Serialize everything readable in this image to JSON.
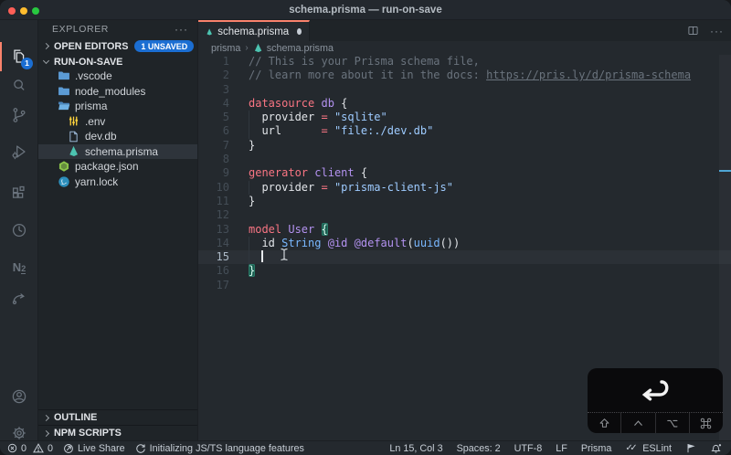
{
  "window": {
    "title": "schema.prisma — run-on-save"
  },
  "activity_bar": {
    "explorer_badge": "1",
    "n2_main": "N",
    "n2_sub": "2"
  },
  "sidebar": {
    "title": "EXPLORER",
    "open_editors_label": "OPEN EDITORS",
    "unsaved_badge": "1 UNSAVED",
    "root_label": "RUN-ON-SAVE",
    "files": [
      {
        "name": ".vscode",
        "icon": "folder",
        "indent": 0
      },
      {
        "name": "node_modules",
        "icon": "folder",
        "indent": 0
      },
      {
        "name": "prisma",
        "icon": "folder-open",
        "indent": 0
      },
      {
        "name": ".env",
        "icon": "env",
        "indent": 1
      },
      {
        "name": "dev.db",
        "icon": "file",
        "indent": 1
      },
      {
        "name": "schema.prisma",
        "icon": "prisma",
        "indent": 1,
        "selected": true
      },
      {
        "name": "package.json",
        "icon": "npm",
        "indent": 0
      },
      {
        "name": "yarn.lock",
        "icon": "yarn",
        "indent": 0
      }
    ],
    "sections": [
      "OUTLINE",
      "NPM SCRIPTS"
    ]
  },
  "tab": {
    "label": "schema.prisma",
    "modified": true
  },
  "breadcrumb": {
    "folder": "prisma",
    "file": "schema.prisma"
  },
  "editor": {
    "cursor_line": 15,
    "cursor_col": 3,
    "lines": [
      {
        "s": [
          [
            "// This is your Prisma schema file,",
            "cm"
          ]
        ]
      },
      {
        "s": [
          [
            "// learn more about it in the docs: ",
            "cm"
          ],
          [
            "https://pris.ly/d/prisma-schema",
            "cm lk"
          ]
        ]
      },
      {
        "s": []
      },
      {
        "s": [
          [
            "datasource",
            "kw"
          ],
          [
            " ",
            ""
          ],
          [
            "db",
            "en"
          ],
          [
            " ",
            ""
          ],
          [
            "{",
            ""
          ]
        ]
      },
      {
        "s": [
          [
            "  provider ",
            ""
          ],
          [
            "=",
            "kw"
          ],
          [
            " ",
            ""
          ],
          [
            "\"sqlite\"",
            "st"
          ]
        ],
        "g": true
      },
      {
        "s": [
          [
            "  url      ",
            ""
          ],
          [
            "=",
            "kw"
          ],
          [
            " ",
            ""
          ],
          [
            "\"file:./dev.db\"",
            "st"
          ]
        ],
        "g": true
      },
      {
        "s": [
          [
            "}",
            ""
          ]
        ]
      },
      {
        "s": []
      },
      {
        "s": [
          [
            "generator",
            "kw"
          ],
          [
            " ",
            ""
          ],
          [
            "client",
            "en"
          ],
          [
            " ",
            ""
          ],
          [
            "{",
            ""
          ]
        ]
      },
      {
        "s": [
          [
            "  provider ",
            ""
          ],
          [
            "=",
            "kw"
          ],
          [
            " ",
            ""
          ],
          [
            "\"prisma-client-js\"",
            "st"
          ]
        ],
        "g": true
      },
      {
        "s": [
          [
            "}",
            ""
          ]
        ]
      },
      {
        "s": []
      },
      {
        "s": [
          [
            "model",
            "kw"
          ],
          [
            " ",
            ""
          ],
          [
            "User",
            "en"
          ],
          [
            " ",
            ""
          ],
          [
            "{",
            "bm"
          ]
        ]
      },
      {
        "s": [
          [
            "  id ",
            ""
          ],
          [
            "String",
            "ty"
          ],
          [
            " ",
            ""
          ],
          [
            "@id",
            "en"
          ],
          [
            " ",
            ""
          ],
          [
            "@default",
            "en"
          ],
          [
            "(",
            ""
          ],
          [
            "uuid",
            "ty"
          ],
          [
            "())",
            ""
          ]
        ],
        "g": true
      },
      {
        "s": [
          [
            "  ",
            ""
          ],
          [
            "",
            "caret"
          ]
        ],
        "cur": true,
        "g": true
      },
      {
        "s": [
          [
            "}",
            "bm"
          ]
        ]
      },
      {
        "s": []
      }
    ]
  },
  "status_bar": {
    "errors": "0",
    "warnings": "0",
    "live_share": "Live Share",
    "message": "Initializing JS/TS language features",
    "line_col": "Ln 15, Col 3",
    "indentation": "Spaces: 2",
    "encoding": "UTF-8",
    "eol": "LF",
    "language": "Prisma",
    "eslint_check": "✓✓",
    "eslint": "ESLint"
  },
  "key_overlay": {
    "main_key": "return",
    "modifier_keys": [
      "shift",
      "control",
      "option",
      "command"
    ]
  },
  "colors": {
    "accent_orange": "#f9826c",
    "badge_blue": "#1b6ed2",
    "keyword": "#f97583",
    "entity": "#b392f0",
    "string": "#9ecbff",
    "type": "#79b8ff",
    "comment": "#6a737d",
    "bracket_match_bg": "#1b5e50"
  }
}
